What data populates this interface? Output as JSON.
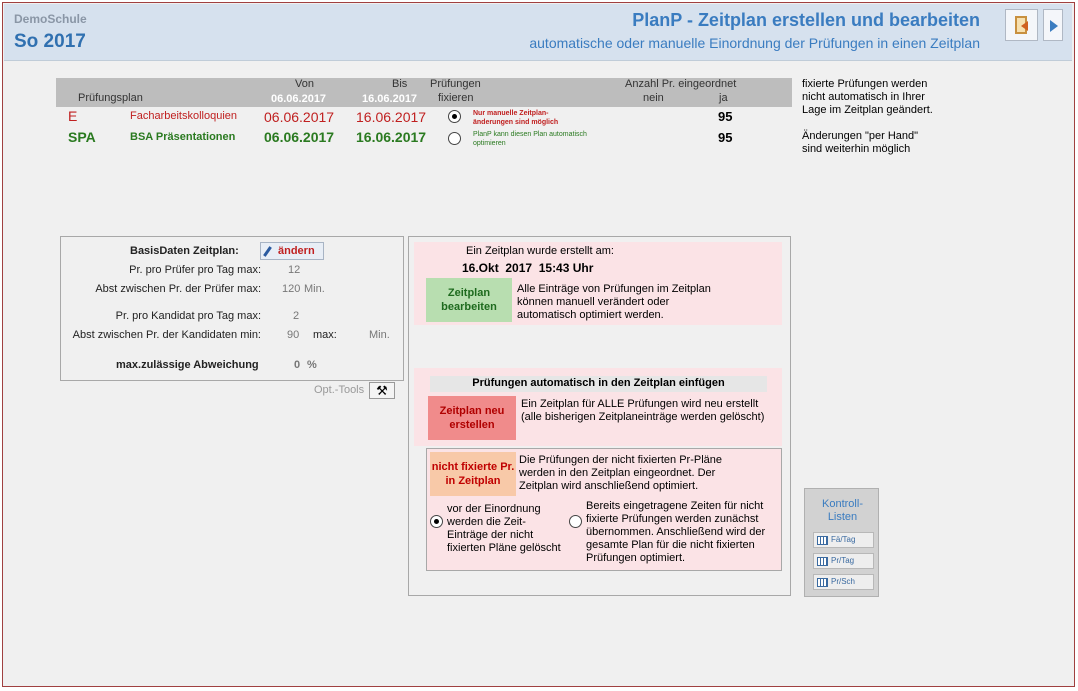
{
  "header": {
    "school": "DemoSchule",
    "term": "So 2017",
    "title": "PlanP - Zeitplan erstellen und bearbeiten",
    "subtitle": "automatische oder manuelle Einordnung der Prüfungen in einen Zeitplan"
  },
  "plan_table": {
    "col_plan": "Prüfungsplan",
    "col_from": "Von",
    "col_from_date": "06.06.2017",
    "col_to": "Bis",
    "col_to_date": "16.06.2017",
    "col_fix_1": "Prüfungen",
    "col_fix_2": "fixieren",
    "col_count": "Anzahl Pr. eingeordnet",
    "col_no": "nein",
    "col_yes": "ja",
    "rows": [
      {
        "code": "E",
        "name": "Facharbeitskolloquien",
        "from": "06.06.2017",
        "to": "16.06.2017",
        "fixed": true,
        "note_1": "Nur manuelle Zeitplan-",
        "note_2": "änderungen sind möglich",
        "no": "",
        "yes": "95"
      },
      {
        "code": "SPA",
        "name": "BSA Präsentationen",
        "from": "06.06.2017",
        "to": "16.06.2017",
        "fixed": false,
        "note_1": "PlanP kann diesen Plan automatisch",
        "note_2": "optimieren",
        "no": "",
        "yes": "95"
      }
    ]
  },
  "side_note": {
    "line1": "fixierte Prüfungen werden",
    "line2": "nicht automatisch in Ihrer",
    "line3": "Lage im Zeitplan geändert.",
    "line4": "Änderungen \"per Hand\"",
    "line5": "sind weiterhin möglich"
  },
  "basis": {
    "title": "BasisDaten Zeitplan:",
    "edit_label": "ändern",
    "per_examiner_label": "Pr. pro Prüfer pro Tag max:",
    "per_examiner_value": "12",
    "gap_examiner_label": "Abst zwischen Pr. der Prüfer max:",
    "gap_examiner_value": "120",
    "gap_examiner_unit": "Min.",
    "per_candidate_label": "Pr. pro Kandidat pro Tag max:",
    "per_candidate_value": "2",
    "gap_candidate_label": "Abst zwischen Pr. der Kandidaten min:",
    "gap_candidate_value": "90",
    "gap_candidate_max": "max:",
    "gap_candidate_unit": "Min.",
    "deviation_label": "max.zulässige Abweichung",
    "deviation_value": "0",
    "deviation_unit": "%",
    "opt_tools": "Opt.-Tools"
  },
  "created": {
    "label": "Ein Zeitplan wurde erstellt am:",
    "date": "16.Okt  2017  15:43 Uhr",
    "edit_btn": "Zeitplan bearbeiten",
    "edit_text_1": "Alle Einträge von Prüfungen im Zeitplan",
    "edit_text_2": "können manuell verändert oder",
    "edit_text_3": "automatisch optimiert werden."
  },
  "auto": {
    "title": "Prüfungen automatisch  in den Zeitplan einfügen",
    "new_btn": "Zeitplan neu erstellen",
    "new_text_1": "Ein Zeitplan für ALLE Prüfungen wird neu erstellt",
    "new_text_2": "(alle bisherigen Zeitplaneinträge werden gelöscht)",
    "nonfixed_btn": "nicht fixierte Pr. in Zeitplan",
    "nonfixed_text_1": "Die Prüfungen der nicht fixierten Pr-Pläne",
    "nonfixed_text_2": "werden in den Zeitplan eingeordnet. Der",
    "nonfixed_text_3": "Zeitplan wird anschließend optimiert.",
    "opt1_1": "vor der Einordnung",
    "opt1_2": "werden die Zeit-",
    "opt1_3": "Einträge der nicht",
    "opt1_4": "fixierten Pläne gelöscht",
    "opt1_selected": true,
    "opt2_1": "Bereits eingetragene Zeiten für nicht",
    "opt2_2": "fixierte Prüfungen werden zunächst",
    "opt2_3": "übernommen. Anschließend wird der",
    "opt2_4": "gesamte Plan für die nicht fixierten",
    "opt2_5": "Prüfungen optimiert.",
    "opt2_selected": false
  },
  "kontroll": {
    "title_1": "Kontroll-",
    "title_2": "Listen",
    "btn1": "Fä/Tag",
    "btn2": "Pr/Tag",
    "btn3": "Pr/Sch"
  },
  "colors": {
    "accent": "#3a7cc0",
    "red": "#c02020",
    "green": "#2a7a20",
    "pink": "#fbe3e6"
  }
}
